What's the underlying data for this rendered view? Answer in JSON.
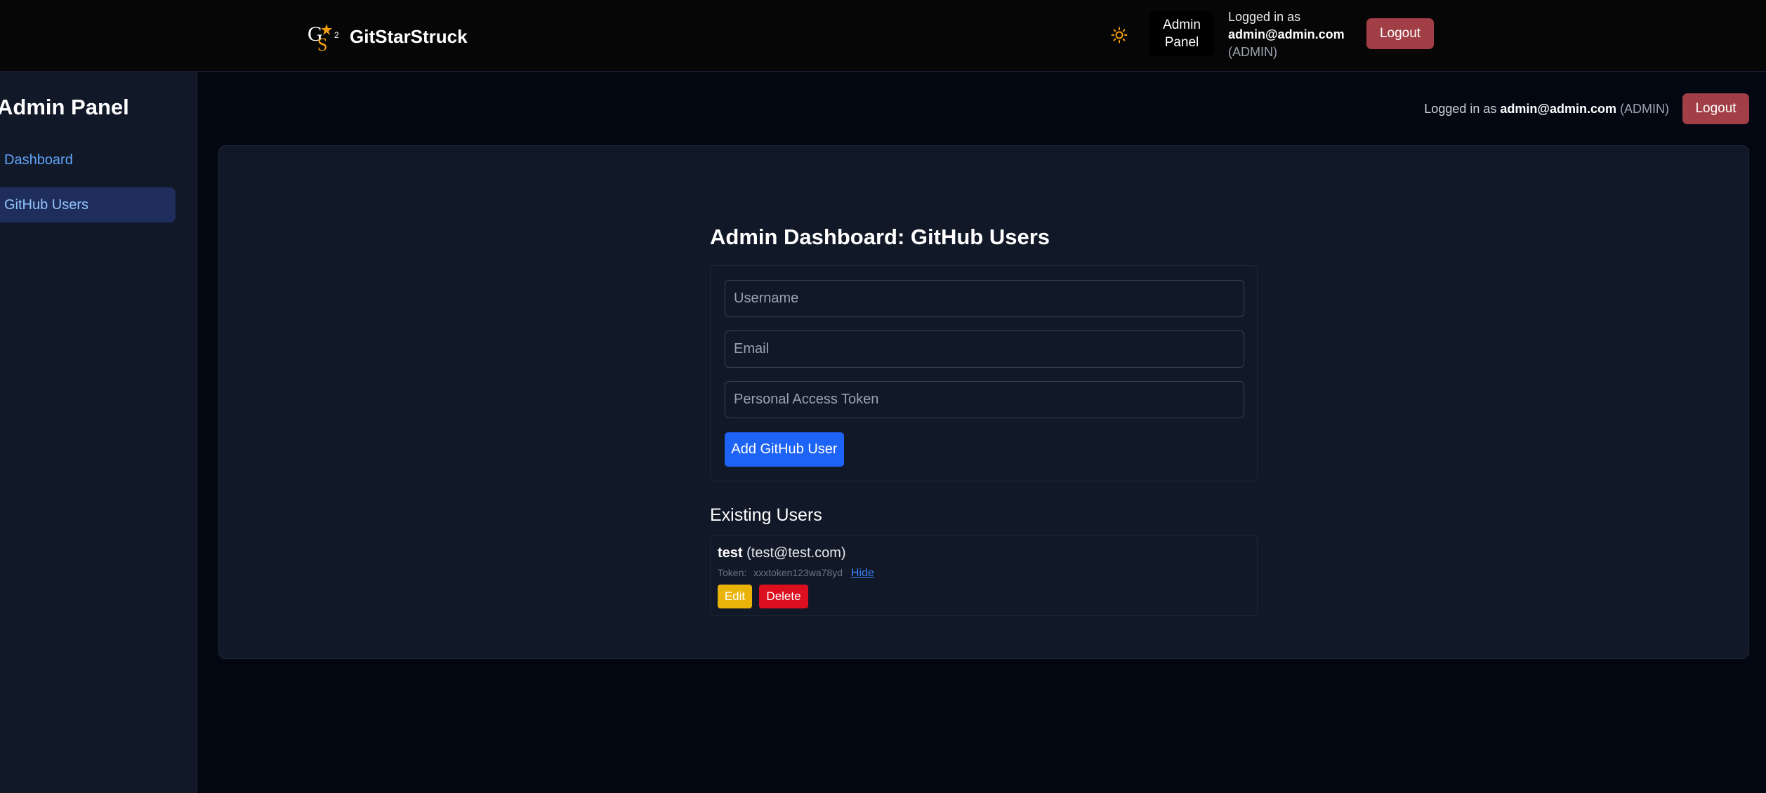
{
  "header": {
    "brand_name": "GitStarStruck",
    "logo_icon": "gss-logo-icon",
    "theme_icon": "sun-icon",
    "admin_panel_label_line1": "Admin",
    "admin_panel_label_line2": "Panel",
    "logged_in_prefix": "Logged in as",
    "email": "admin@admin.com",
    "role": "(ADMIN)",
    "logout_label": "Logout"
  },
  "sidebar": {
    "title": "Admin Panel",
    "items": [
      {
        "label": "Dashboard"
      },
      {
        "label": "GitHub Users"
      }
    ]
  },
  "main": {
    "login_prefix": "Logged in as",
    "email": "admin@admin.com",
    "role": "(ADMIN)",
    "logout_label": "Logout",
    "page_title": "Admin Dashboard: GitHub Users",
    "form": {
      "username_placeholder": "Username",
      "email_placeholder": "Email",
      "token_placeholder": "Personal Access Token",
      "submit_label": "Add GitHub User"
    },
    "existing_title": "Existing Users",
    "users": [
      {
        "username": "test",
        "email": "(test@test.com)",
        "token_label": "Token:",
        "token": "xxxtoken123wa78yd",
        "hide_label": "Hide",
        "edit_label": "Edit",
        "delete_label": "Delete"
      }
    ]
  },
  "colors": {
    "accent": "#1d63f5",
    "logout": "#a23f46",
    "edit": "#eab308",
    "delete": "#dc0f1f",
    "link": "#3b82f6"
  }
}
